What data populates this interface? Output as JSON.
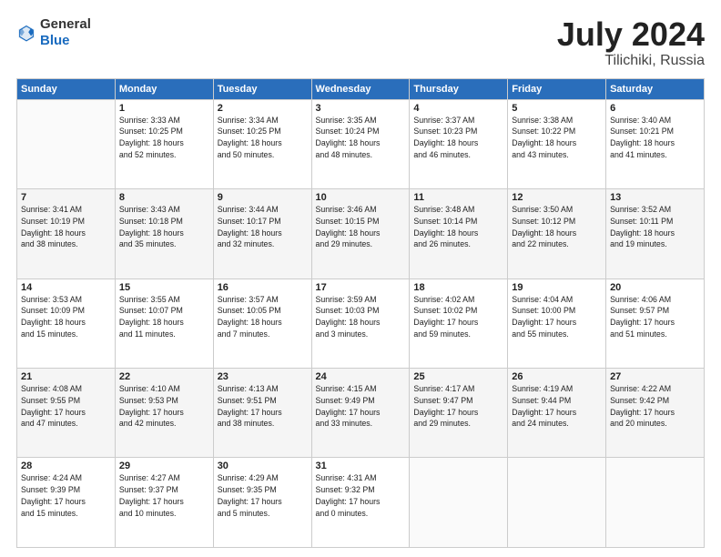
{
  "header": {
    "logo_general": "General",
    "logo_blue": "Blue",
    "title": "July 2024",
    "location": "Tilichiki, Russia"
  },
  "days_of_week": [
    "Sunday",
    "Monday",
    "Tuesday",
    "Wednesday",
    "Thursday",
    "Friday",
    "Saturday"
  ],
  "weeks": [
    [
      {
        "num": "",
        "info": ""
      },
      {
        "num": "1",
        "info": "Sunrise: 3:33 AM\nSunset: 10:25 PM\nDaylight: 18 hours\nand 52 minutes."
      },
      {
        "num": "2",
        "info": "Sunrise: 3:34 AM\nSunset: 10:25 PM\nDaylight: 18 hours\nand 50 minutes."
      },
      {
        "num": "3",
        "info": "Sunrise: 3:35 AM\nSunset: 10:24 PM\nDaylight: 18 hours\nand 48 minutes."
      },
      {
        "num": "4",
        "info": "Sunrise: 3:37 AM\nSunset: 10:23 PM\nDaylight: 18 hours\nand 46 minutes."
      },
      {
        "num": "5",
        "info": "Sunrise: 3:38 AM\nSunset: 10:22 PM\nDaylight: 18 hours\nand 43 minutes."
      },
      {
        "num": "6",
        "info": "Sunrise: 3:40 AM\nSunset: 10:21 PM\nDaylight: 18 hours\nand 41 minutes."
      }
    ],
    [
      {
        "num": "7",
        "info": "Sunrise: 3:41 AM\nSunset: 10:19 PM\nDaylight: 18 hours\nand 38 minutes."
      },
      {
        "num": "8",
        "info": "Sunrise: 3:43 AM\nSunset: 10:18 PM\nDaylight: 18 hours\nand 35 minutes."
      },
      {
        "num": "9",
        "info": "Sunrise: 3:44 AM\nSunset: 10:17 PM\nDaylight: 18 hours\nand 32 minutes."
      },
      {
        "num": "10",
        "info": "Sunrise: 3:46 AM\nSunset: 10:15 PM\nDaylight: 18 hours\nand 29 minutes."
      },
      {
        "num": "11",
        "info": "Sunrise: 3:48 AM\nSunset: 10:14 PM\nDaylight: 18 hours\nand 26 minutes."
      },
      {
        "num": "12",
        "info": "Sunrise: 3:50 AM\nSunset: 10:12 PM\nDaylight: 18 hours\nand 22 minutes."
      },
      {
        "num": "13",
        "info": "Sunrise: 3:52 AM\nSunset: 10:11 PM\nDaylight: 18 hours\nand 19 minutes."
      }
    ],
    [
      {
        "num": "14",
        "info": "Sunrise: 3:53 AM\nSunset: 10:09 PM\nDaylight: 18 hours\nand 15 minutes."
      },
      {
        "num": "15",
        "info": "Sunrise: 3:55 AM\nSunset: 10:07 PM\nDaylight: 18 hours\nand 11 minutes."
      },
      {
        "num": "16",
        "info": "Sunrise: 3:57 AM\nSunset: 10:05 PM\nDaylight: 18 hours\nand 7 minutes."
      },
      {
        "num": "17",
        "info": "Sunrise: 3:59 AM\nSunset: 10:03 PM\nDaylight: 18 hours\nand 3 minutes."
      },
      {
        "num": "18",
        "info": "Sunrise: 4:02 AM\nSunset: 10:02 PM\nDaylight: 17 hours\nand 59 minutes."
      },
      {
        "num": "19",
        "info": "Sunrise: 4:04 AM\nSunset: 10:00 PM\nDaylight: 17 hours\nand 55 minutes."
      },
      {
        "num": "20",
        "info": "Sunrise: 4:06 AM\nSunset: 9:57 PM\nDaylight: 17 hours\nand 51 minutes."
      }
    ],
    [
      {
        "num": "21",
        "info": "Sunrise: 4:08 AM\nSunset: 9:55 PM\nDaylight: 17 hours\nand 47 minutes."
      },
      {
        "num": "22",
        "info": "Sunrise: 4:10 AM\nSunset: 9:53 PM\nDaylight: 17 hours\nand 42 minutes."
      },
      {
        "num": "23",
        "info": "Sunrise: 4:13 AM\nSunset: 9:51 PM\nDaylight: 17 hours\nand 38 minutes."
      },
      {
        "num": "24",
        "info": "Sunrise: 4:15 AM\nSunset: 9:49 PM\nDaylight: 17 hours\nand 33 minutes."
      },
      {
        "num": "25",
        "info": "Sunrise: 4:17 AM\nSunset: 9:47 PM\nDaylight: 17 hours\nand 29 minutes."
      },
      {
        "num": "26",
        "info": "Sunrise: 4:19 AM\nSunset: 9:44 PM\nDaylight: 17 hours\nand 24 minutes."
      },
      {
        "num": "27",
        "info": "Sunrise: 4:22 AM\nSunset: 9:42 PM\nDaylight: 17 hours\nand 20 minutes."
      }
    ],
    [
      {
        "num": "28",
        "info": "Sunrise: 4:24 AM\nSunset: 9:39 PM\nDaylight: 17 hours\nand 15 minutes."
      },
      {
        "num": "29",
        "info": "Sunrise: 4:27 AM\nSunset: 9:37 PM\nDaylight: 17 hours\nand 10 minutes."
      },
      {
        "num": "30",
        "info": "Sunrise: 4:29 AM\nSunset: 9:35 PM\nDaylight: 17 hours\nand 5 minutes."
      },
      {
        "num": "31",
        "info": "Sunrise: 4:31 AM\nSunset: 9:32 PM\nDaylight: 17 hours\nand 0 minutes."
      },
      {
        "num": "",
        "info": ""
      },
      {
        "num": "",
        "info": ""
      },
      {
        "num": "",
        "info": ""
      }
    ]
  ]
}
